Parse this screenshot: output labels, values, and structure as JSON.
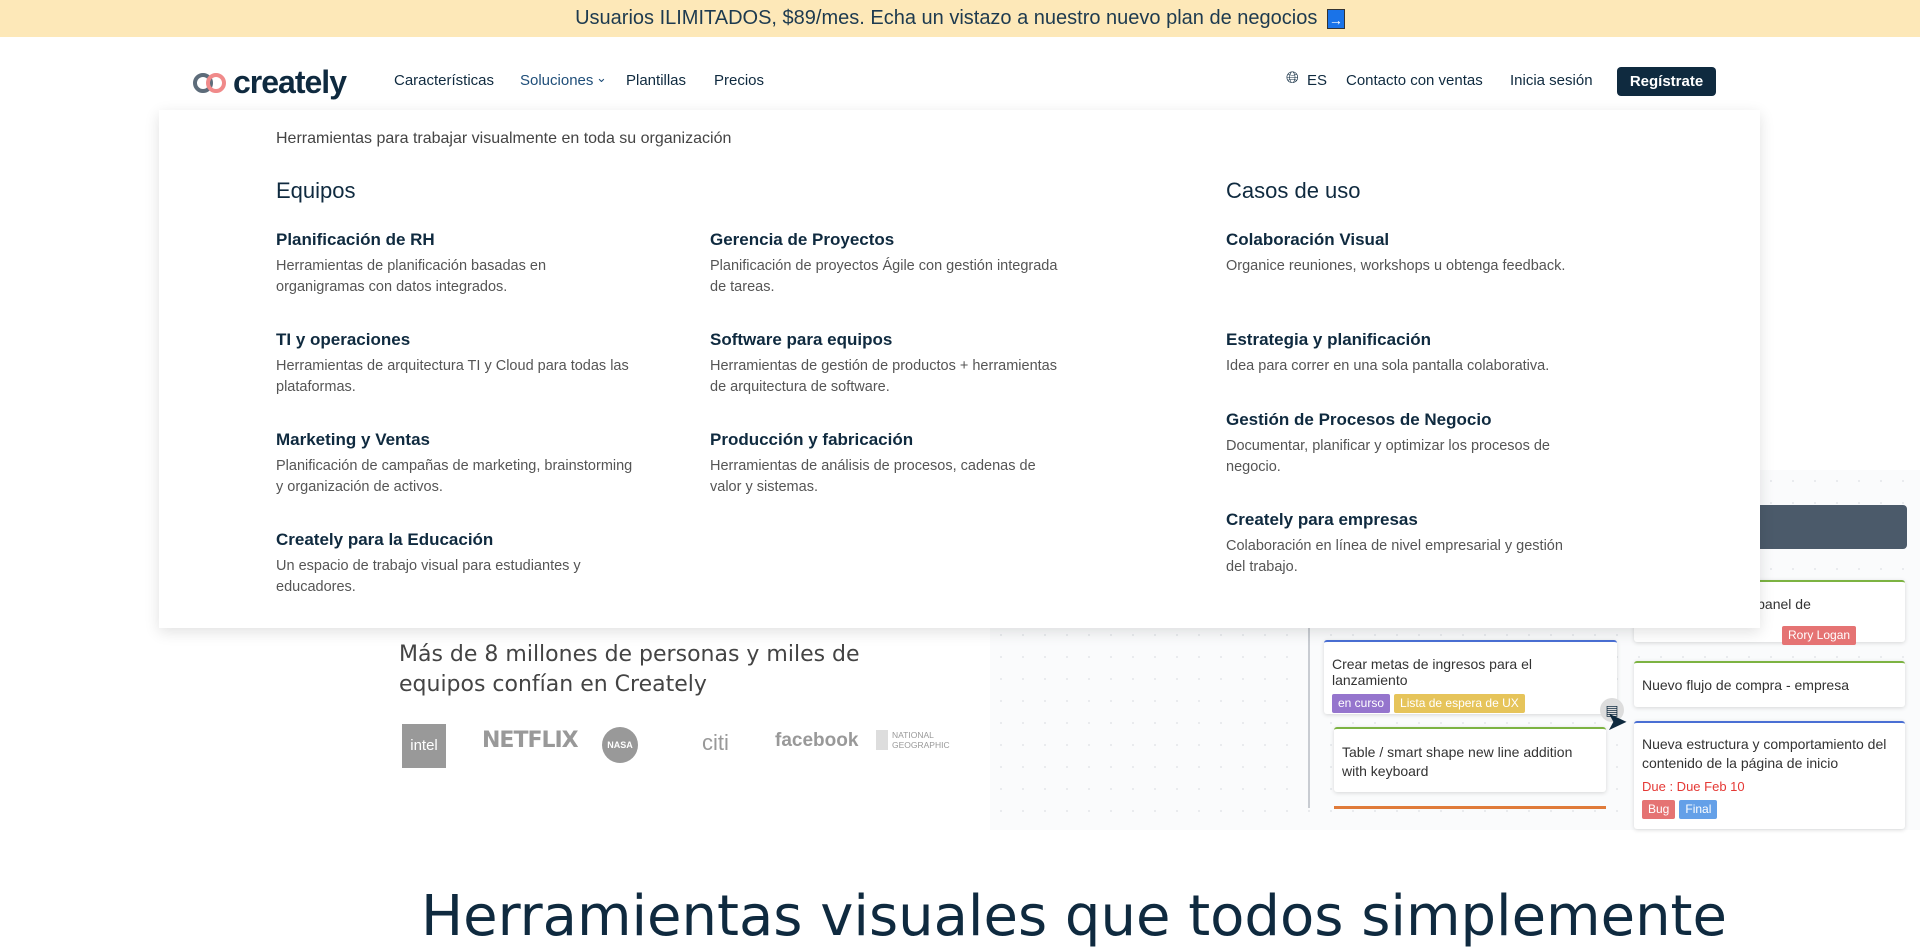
{
  "banner": {
    "text": "Usuarios ILIMITADOS, $89/mes. Echa un vistazo a nuestro nuevo plan de negocios",
    "arrow": "→"
  },
  "nav": {
    "logo": "creately",
    "items": [
      "Características",
      "Soluciones",
      "Plantillas",
      "Precios"
    ],
    "lang": "ES",
    "contact": "Contacto con ventas",
    "login": "Inicia sesión",
    "signup": "Regístrate"
  },
  "menu": {
    "intro": "Herramientas para trabajar visualmente en toda su organización",
    "teams_heading": "Equipos",
    "cases_heading": "Casos de uso",
    "teams": [
      {
        "title": "Planificación de RH",
        "desc": "Herramientas de planificación basadas en organigramas con datos integrados."
      },
      {
        "title": "Gerencia de Proyectos",
        "desc": "Planificación de proyectos Ágile con gestión integrada de tareas."
      },
      {
        "title": "TI y operaciones",
        "desc": "Herramientas de arquitectura TI y Cloud para todas las plataformas."
      },
      {
        "title": "Software para equipos",
        "desc": "Herramientas de gestión de productos + herramientas de arquitectura de software."
      },
      {
        "title": "Marketing y Ventas",
        "desc": "Planificación de campañas de marketing, brainstorming y organización de activos."
      },
      {
        "title": "Producción y fabricación",
        "desc": "Herramientas de análisis de procesos, cadenas de valor y sistemas."
      },
      {
        "title": "Creately para la Educación",
        "desc": "Un espacio de trabajo visual para estudiantes y educadores."
      }
    ],
    "cases": [
      {
        "title": "Colaboración Visual",
        "desc": "Organice reuniones, workshops u obtenga feedback."
      },
      {
        "title": "Estrategia y planificación",
        "desc": "Idea para correr en una sola pantalla colaborativa."
      },
      {
        "title": "Gestión de Procesos de Negocio",
        "desc": "Documentar, planificar y optimizar los procesos de negocio."
      },
      {
        "title": "Creately para empresas",
        "desc": "Colaboración en línea de nivel empresarial y gestión del trabajo."
      }
    ]
  },
  "hero": {
    "trust": "Más de 8 millones de personas y miles de equipos confían en Creately",
    "logos": [
      "intel",
      "NETFLIX",
      "NASA",
      "citi",
      "facebook",
      "NATIONAL GEOGRAPHIC"
    ]
  },
  "board": {
    "card1": "atos al panel de",
    "cursor_user": "Rory Logan",
    "card2": "Crear metas  de ingresos para el lanzamiento",
    "tag_a": "en curso",
    "tag_b": "Lista de espera de UX",
    "card3": "Nuevo flujo de compra - empresa",
    "card4": "Table / smart shape new line addition with keyboard",
    "card5": "Nueva estructura y comportamiento del contenido de la página de inicio",
    "due": "Due : Due Feb 10",
    "tag_c": "Bug",
    "tag_d": "Final"
  },
  "section": {
    "heading": "Herramientas visuales que todos simplemente"
  }
}
